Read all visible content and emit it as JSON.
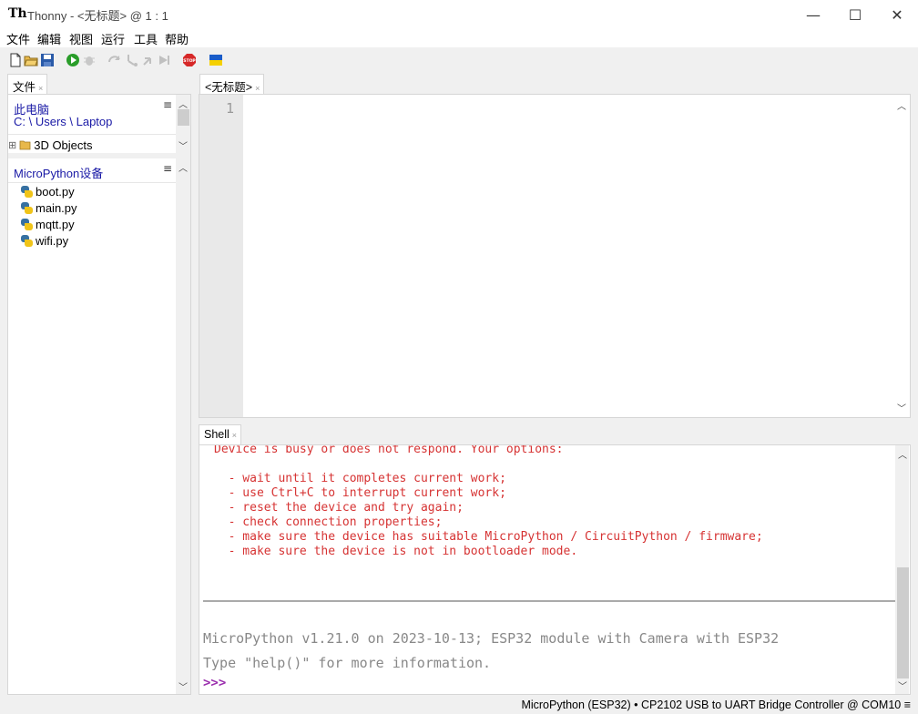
{
  "window": {
    "app_logo": "Th",
    "title": "Thonny  -  <无标题>  @  1 : 1",
    "minimize_glyph": "—",
    "maximize_glyph": "☐",
    "close_glyph": "✕"
  },
  "menu": [
    "文件",
    "编辑",
    "视图",
    "运行",
    "工具",
    "帮助"
  ],
  "toolbar": {
    "icons": [
      "new-file-icon",
      "open-file-icon",
      "save-icon",
      "run-icon",
      "debug-icon",
      "step-over-icon",
      "step-into-icon",
      "step-out-icon",
      "resume-icon",
      "stop-icon",
      "ukraine-flag-icon"
    ],
    "stop_label": "STOP"
  },
  "files_panel": {
    "tab_label": "文件",
    "tab_close": "×",
    "menu_glyph": "≡",
    "computer": {
      "title": "此电脑",
      "path": "C: \\ Users \\ Laptop",
      "items": [
        {
          "expander": "⊞",
          "name": "3D Objects"
        }
      ]
    },
    "device": {
      "title": "MicroPython设备",
      "items": [
        "boot.py",
        "main.py",
        "mqtt.py",
        "wifi.py"
      ]
    }
  },
  "editor": {
    "tab_label": "<无标题>",
    "tab_close": "×",
    "line_numbers": [
      "1"
    ]
  },
  "shell": {
    "tab_label": "Shell",
    "tab_close": "×",
    "error_lines": [
      "Device is busy or does not respond. Your options:",
      "",
      "  - wait until it completes current work;",
      "  - use Ctrl+C to interrupt current work;",
      "  - reset the device and try again;",
      "  - check connection properties;",
      "  - make sure the device has suitable MicroPython / CircuitPython / firmware;",
      "  - make sure the device is not in bootloader mode."
    ],
    "banner_line1": "MicroPython v1.21.0 on 2023-10-13; ESP32 module with Camera with ESP32",
    "banner_line2": "Type \"help()\" for more information.",
    "prompt": ">>>"
  },
  "status": {
    "text": "MicroPython (ESP32)  •  CP2102 USB to UART Bridge Controller @ COM10  ≡"
  },
  "colors": {
    "error_text": "#d63333",
    "prompt": "#9b2fae",
    "link_blue": "#1a1aa6",
    "run_green": "#2a9d2a"
  }
}
